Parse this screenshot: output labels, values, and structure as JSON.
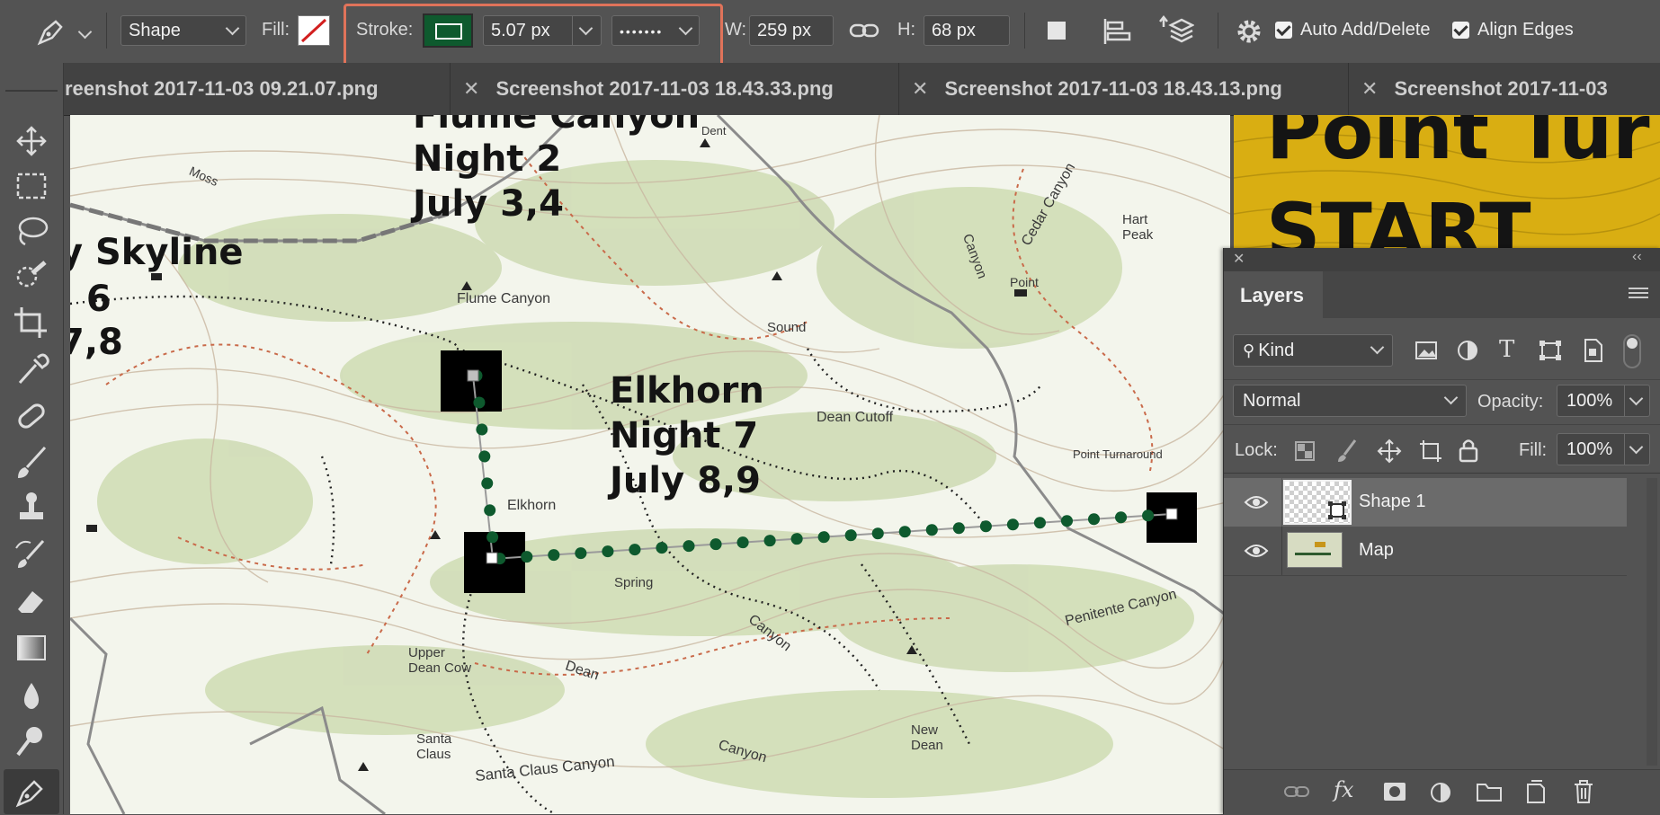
{
  "options_bar": {
    "mode_value": "Shape",
    "fill_label": "Fill:",
    "stroke_label": "Stroke:",
    "stroke_width": "5.07 px",
    "stroke_style": "•••••••",
    "w_label": "W:",
    "w_value": "259 px",
    "h_label": "H:",
    "h_value": "68 px",
    "auto_add_delete": "Auto Add/Delete",
    "align_edges": "Align Edges",
    "stroke_color": "#0e5a2e",
    "highlight_color": "#e0735a"
  },
  "tabs": [
    {
      "label": "reenshot 2017-11-03 09.21.07.png"
    },
    {
      "label": "Screenshot 2017-11-03 18.43.33.png"
    },
    {
      "label": "Screenshot 2017-11-03 18.43.13.png"
    },
    {
      "label": "Screenshot 2017-11-03"
    }
  ],
  "collapse_glyph": "»",
  "map": {
    "label_flume": "Flume Canyon",
    "label_night2": "Night 2",
    "label_july34": "July 3,4",
    "label_skyline": "y Skyline",
    "label_6": ": 6",
    "label_78": "7,8",
    "label_elkhorn": "Elkhorn",
    "label_night7": "Night 7",
    "label_july89": "July 8,9",
    "label_point": "Point Tur",
    "label_start": "START",
    "topo_labels": [
      "Flume Canyon",
      "Elkhorn",
      "Dean Cutoff",
      "Cedar Canyon",
      "Hart Peak",
      "Point",
      "Sound",
      "Canyon",
      "Penitente Canyon",
      "Upper Dean Cow",
      "Dean",
      "Santa Claus",
      "Santa Claus Canyon",
      "New Dean",
      "Canyon",
      "Moss",
      "Dent",
      "Point Turnaround",
      "Canyon",
      "Spring"
    ]
  },
  "layers_panel": {
    "title": "Layers",
    "kind_label": "Kind",
    "blend_mode": "Normal",
    "opacity_label": "Opacity:",
    "opacity_value": "100%",
    "lock_label": "Lock:",
    "fill_label": "Fill:",
    "fill_value": "100%",
    "layers": [
      {
        "name": "Shape 1",
        "selected": true
      },
      {
        "name": "Map",
        "selected": false
      }
    ]
  }
}
